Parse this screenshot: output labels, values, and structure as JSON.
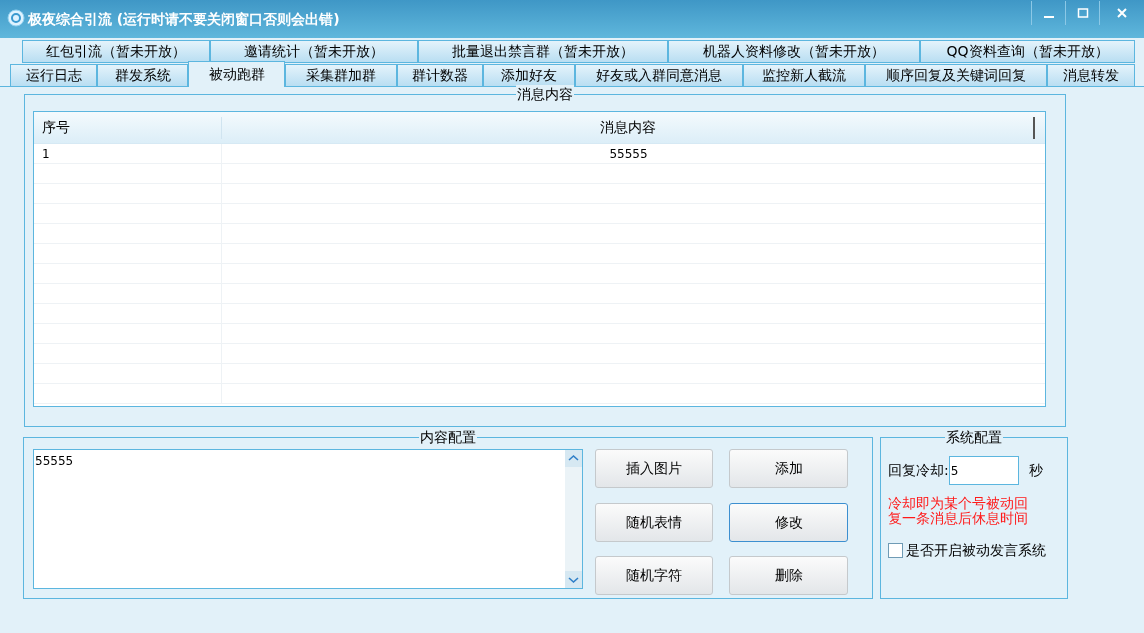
{
  "window": {
    "title": "极夜综合引流 (运行时请不要关闭窗口否则会出错)"
  },
  "tabs_row_1": [
    {
      "label": "红包引流（暂未开放）",
      "selected": false
    },
    {
      "label": "邀请统计（暂未开放）",
      "selected": false
    },
    {
      "label": "批量退出禁言群（暂未开放）",
      "selected": false
    },
    {
      "label": "机器人资料修改（暂未开放）",
      "selected": false
    },
    {
      "label": "QQ资料查询（暂未开放）",
      "selected": false
    }
  ],
  "tabs_row_2": [
    {
      "label": "运行日志",
      "selected": false
    },
    {
      "label": "群发系统",
      "selected": false
    },
    {
      "label": "被动跑群",
      "selected": true
    },
    {
      "label": "采集群加群",
      "selected": false
    },
    {
      "label": "群计数器",
      "selected": false
    },
    {
      "label": "添加好友",
      "selected": false
    },
    {
      "label": "好友或入群同意消息",
      "selected": false
    },
    {
      "label": "监控新人截流",
      "selected": false
    },
    {
      "label": "顺序回复及关键词回复",
      "selected": false
    },
    {
      "label": "消息转发",
      "selected": false
    }
  ],
  "message_group": {
    "title": "消息内容",
    "table": {
      "columns": [
        "序号",
        "消息内容"
      ],
      "rows": [
        [
          "1",
          "55555"
        ]
      ]
    }
  },
  "content_group": {
    "title": "内容配置",
    "text": "55555",
    "buttons": [
      {
        "label": "插入图片",
        "focused": false
      },
      {
        "label": "添加",
        "focused": false
      },
      {
        "label": "随机表情",
        "focused": false
      },
      {
        "label": "修改",
        "focused": true
      },
      {
        "label": "随机字符",
        "focused": false
      },
      {
        "label": "删除",
        "focused": false
      }
    ]
  },
  "system_group": {
    "title": "系统配置",
    "cooldown_label": "回复冷却:",
    "cooldown_value": "5",
    "unit": "秒",
    "note": "冷却即为某个号被动回复一条消息后休息时间",
    "checkbox": {
      "label": "是否开启被动发言系统",
      "checked": false
    }
  }
}
